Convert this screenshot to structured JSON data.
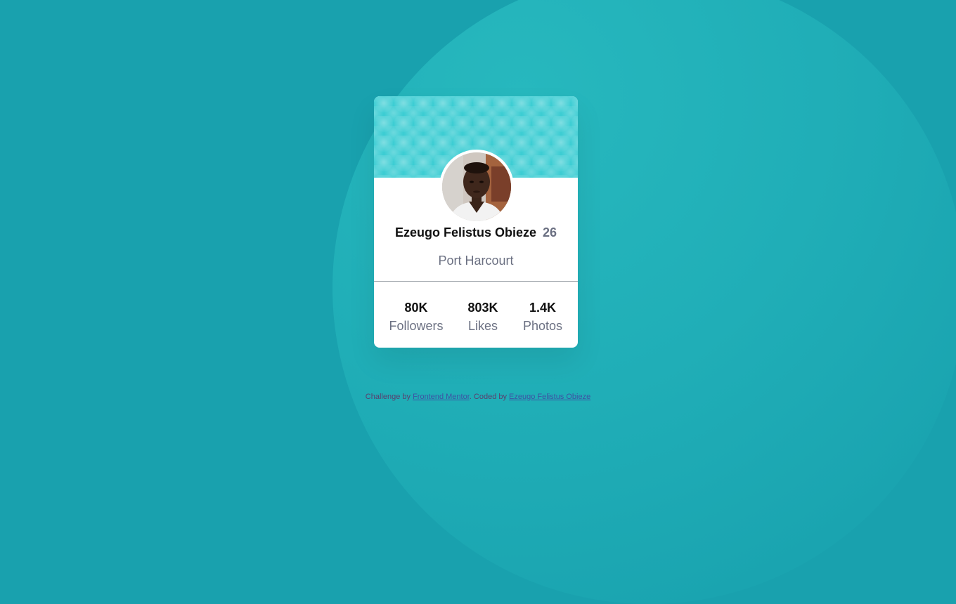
{
  "profile": {
    "name": "Ezeugo Felistus Obieze",
    "age": "26",
    "location": "Port Harcourt"
  },
  "stats": [
    {
      "value": "80K",
      "label": "Followers"
    },
    {
      "value": "803K",
      "label": "Likes"
    },
    {
      "value": "1.4K",
      "label": "Photos"
    }
  ],
  "attribution": {
    "prefix": "Challenge by",
    "challenge_link": "Frontend Mentor",
    "middle": ". Coded by",
    "author_link": "Ezeugo Felistus Obieze"
  },
  "colors": {
    "background": "#19a1ae",
    "banner": "#3ccdd3",
    "muted_text": "#6b7082",
    "link": "#3e52a3"
  }
}
